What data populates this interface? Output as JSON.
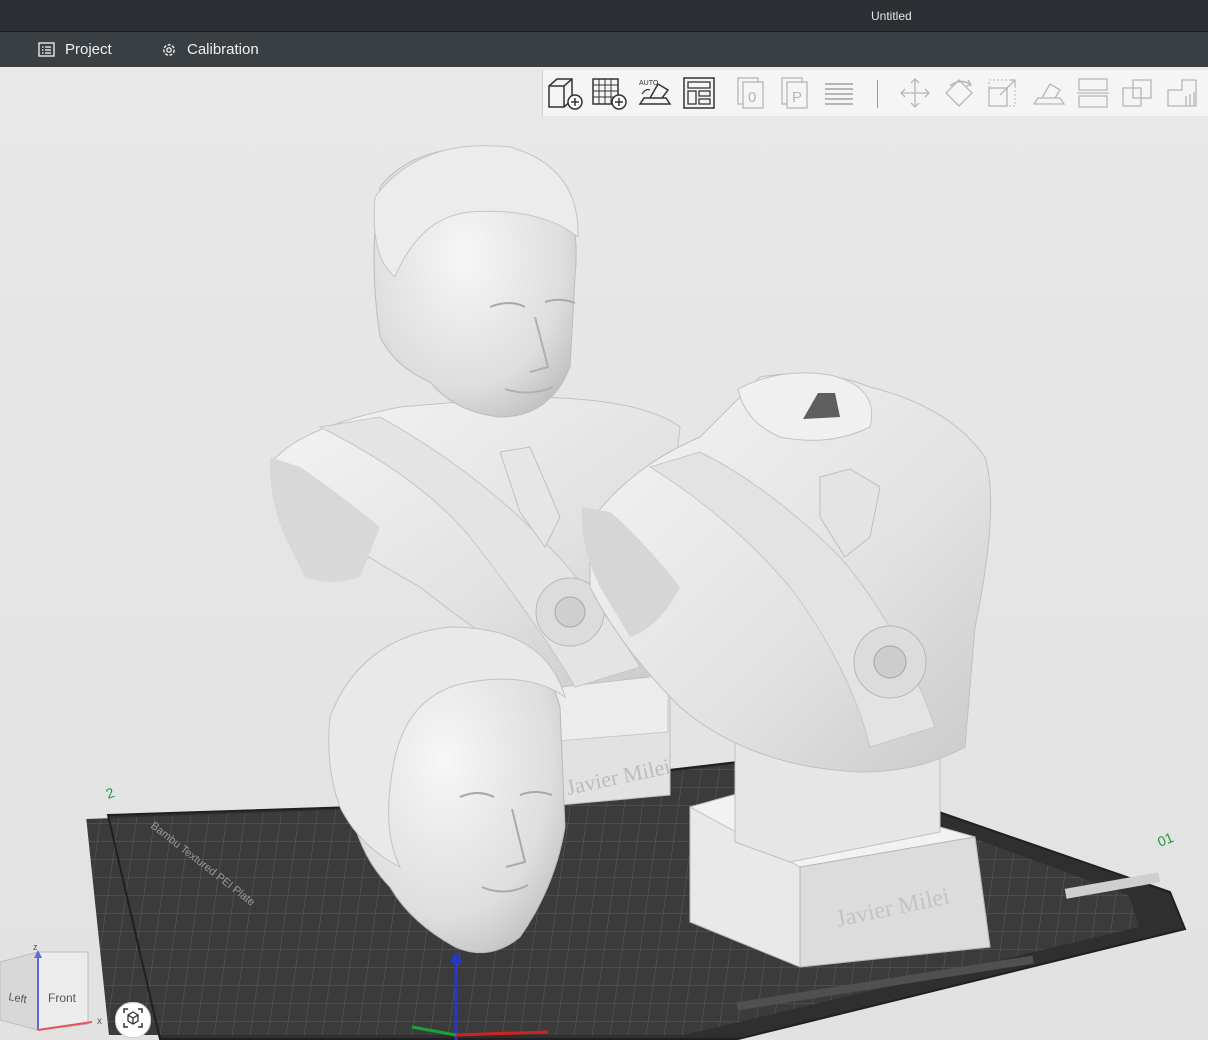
{
  "window": {
    "title": "Untitled"
  },
  "menu": {
    "project_label": "Project",
    "calibration_label": "Calibration"
  },
  "toolbar": {
    "auto_label": "AUTO",
    "plate_badge_0": "0",
    "plate_badge_p": "P"
  },
  "scene": {
    "bust_engraving_back": "Javier Milei",
    "bust_engraving_front": "Javier Milei",
    "plate_side_label": "Bambu Textured PEI Plate",
    "plate_number_left": "2",
    "plate_number_right": "01"
  },
  "navcube": {
    "left_label": "Left",
    "front_label": "Front",
    "z_label": "z",
    "x_label": "x"
  },
  "colors": {
    "menubar": "#3a3f44",
    "titlebar": "#2b2f33",
    "viewport": "#e6e6e6",
    "plate": "#3a3a3a",
    "model": "#e9e9e9",
    "axis_x": "#d42020",
    "axis_y": "#17a23a",
    "axis_z": "#2638c8"
  }
}
